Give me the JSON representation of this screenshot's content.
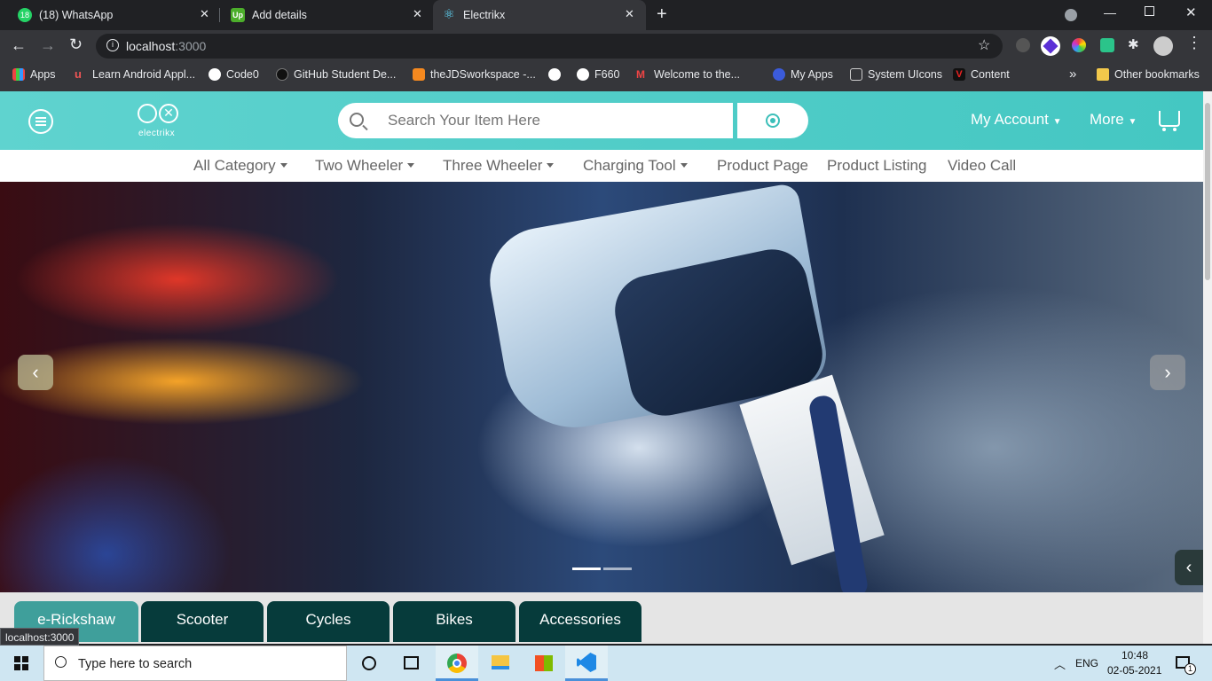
{
  "browser": {
    "tabs": [
      {
        "title": "(18) WhatsApp",
        "badge": "18"
      },
      {
        "title": "Add details",
        "badge": "Up"
      },
      {
        "title": "Electrikx"
      }
    ],
    "new_tab": "+",
    "url": "localhost",
    "url_port": ":3000",
    "bookmarks": [
      {
        "label": "Apps"
      },
      {
        "label": "Learn Android Appl..."
      },
      {
        "label": "Code0"
      },
      {
        "label": "GitHub Student De..."
      },
      {
        "label": "theJDSworkspace -..."
      },
      {
        "label": ""
      },
      {
        "label": "F660"
      },
      {
        "label": "Welcome to the..."
      },
      {
        "label": "My Apps"
      },
      {
        "label": "System UIcons"
      },
      {
        "label": "Content"
      }
    ],
    "other_bookmarks": "Other bookmarks",
    "overflow": "»",
    "status_url": "localhost:3000"
  },
  "site": {
    "logo_text": "electrikx",
    "search": {
      "placeholder": "Search Your Item Here"
    },
    "header_links": {
      "account": "My Account",
      "more": "More"
    },
    "nav": [
      {
        "label": "All Category",
        "dropdown": true
      },
      {
        "label": "Two Wheeler",
        "dropdown": true
      },
      {
        "label": "Three Wheeler",
        "dropdown": true
      },
      {
        "label": "Charging Tool",
        "dropdown": true
      },
      {
        "label": "Product Page",
        "dropdown": false
      },
      {
        "label": "Product Listing",
        "dropdown": false
      },
      {
        "label": "Video Call",
        "dropdown": false
      }
    ],
    "carousel": {
      "prev": "‹",
      "next": "›",
      "side_toggle": "‹"
    },
    "categories": [
      "e-Rickshaw",
      "Scooter",
      "Cycles",
      "Bikes",
      "Accessories"
    ],
    "selected_category": "e-Rickshaw",
    "colors": {
      "header": "#4ecbc6",
      "category_tab": "#063b3b",
      "category_selected": "#3f9f9b"
    }
  },
  "taskbar": {
    "search_placeholder": "Type here to search",
    "lang": "ENG",
    "time": "10:48",
    "date": "02-05-2021",
    "notifications": "1"
  }
}
